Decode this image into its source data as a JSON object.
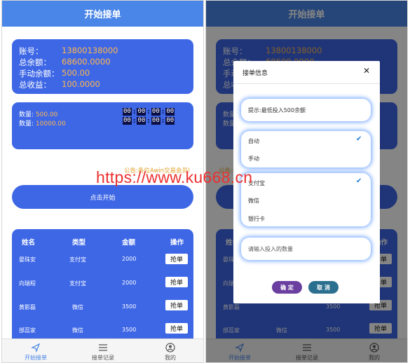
{
  "header": {
    "title": "开始接单"
  },
  "account": {
    "rows": [
      {
        "label": "账号：",
        "value": "13800138000"
      },
      {
        "label": "总余额：",
        "value": "68600.0000"
      },
      {
        "label": "手动余额：",
        "value": "500.00"
      },
      {
        "label": "总收益：",
        "value": "100.0000"
      }
    ]
  },
  "quantity": {
    "rows": [
      {
        "label": "数量:",
        "value": "500.00"
      },
      {
        "label": "数量:",
        "value": "10000.00"
      }
    ],
    "timer1": [
      "00",
      "00",
      "00",
      "00"
    ],
    "timer2": [
      "00",
      "00",
      "00",
      "00"
    ]
  },
  "notice": "公告:各位Awin交易会员!",
  "start_button": "点击开始",
  "table": {
    "headers": [
      "姓名",
      "类型",
      "金额",
      "操作"
    ],
    "rows": [
      {
        "name": "晏珠安",
        "type": "支付宝",
        "amount": "2000",
        "action": "抢单"
      },
      {
        "name": "向瑞程",
        "type": "支付宝",
        "amount": "2000",
        "action": "抢单"
      },
      {
        "name": "黄影磊",
        "type": "微信",
        "amount": "3500",
        "action": "抢单"
      },
      {
        "name": "邰蕊家",
        "type": "微信",
        "amount": "3500",
        "action": "抢单"
      }
    ]
  },
  "tabbar": {
    "items": [
      {
        "label": "开始接单",
        "icon": "send-icon",
        "active": true
      },
      {
        "label": "接单记录",
        "icon": "list-icon",
        "active": false
      },
      {
        "label": "我的",
        "icon": "user-icon",
        "active": false
      }
    ]
  },
  "modal": {
    "title": "接单信息",
    "close": "✕",
    "hint": "提示:最低投入500余额",
    "mode_options": [
      "自动",
      "手动"
    ],
    "channel_options": [
      "支付宝",
      "微信",
      "银行卡"
    ],
    "amount_placeholder": "请输入投入的数量",
    "confirm": "确 定",
    "cancel": "取 消"
  },
  "watermark": "https://www.ku668.cn",
  "colors": {
    "primary": "#4a86e8",
    "card": "#3e67e6",
    "accent": "#ffb74d",
    "confirm": "#6a3fa0",
    "cancel": "#2b6f8f"
  }
}
